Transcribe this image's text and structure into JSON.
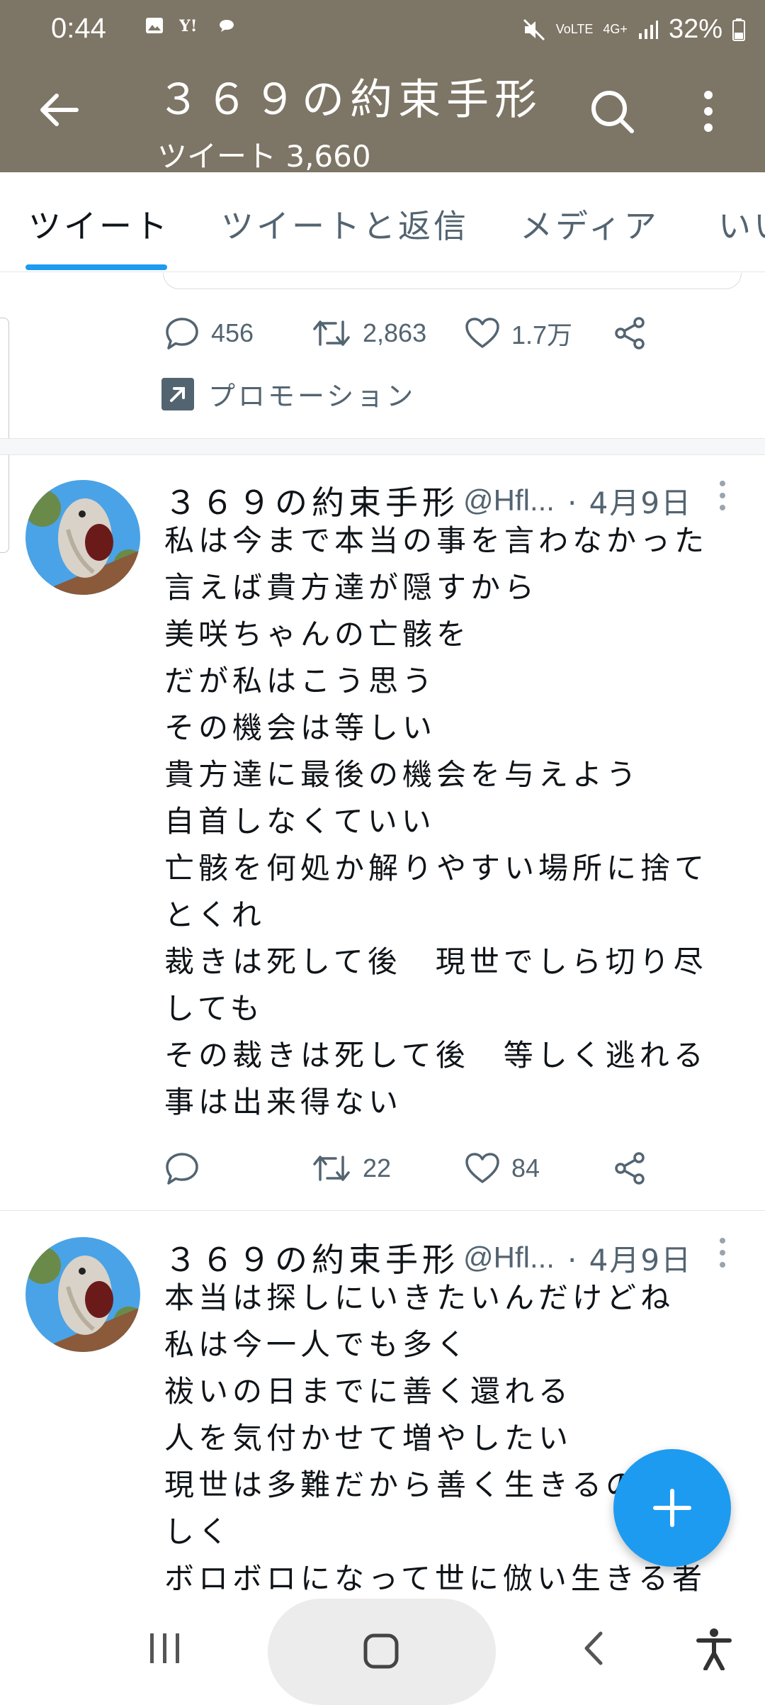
{
  "status_bar": {
    "time": "0:44",
    "left_icons": [
      "image-icon",
      "yahoo-icon",
      "bubble-icon"
    ],
    "mute_icon": "mute-icon",
    "volte": "VoLTE",
    "network": "4G+",
    "battery": "32%"
  },
  "header": {
    "title": "３６９の約束手形",
    "tweet_count": "ツイート 3,660"
  },
  "tabs": [
    {
      "label": "ツイート",
      "active": true
    },
    {
      "label": "ツイートと返信",
      "active": false
    },
    {
      "label": "メディア",
      "active": false
    },
    {
      "label": "いいね",
      "active": false
    }
  ],
  "prev_tweet": {
    "replies": "456",
    "retweets": "2,863",
    "likes": "1.7万",
    "promotion_label": "プロモーション"
  },
  "tweets": [
    {
      "name": "３６９の約束手形",
      "handle": "@Hfl...",
      "date": "· 4月9日",
      "lines": [
        "私は今まで本当の事を言わなかった",
        "言えば貴方達が隠すから",
        "美咲ちゃんの亡骸を",
        "だが私はこう思う",
        "その機会は等しい",
        "貴方達に最後の機会を与えよう",
        "自首しなくていい",
        "亡骸を何処か解りやすい場所に捨て",
        "とくれ",
        "裁きは死して後　現世でしら切り尽",
        "しても",
        "その裁きは死して後　等しく逃れる",
        "事は出来得ない"
      ],
      "replies": "",
      "retweets": "22",
      "likes": "84"
    },
    {
      "name": "３６９の約束手形",
      "handle": "@Hfl...",
      "date": "· 4月9日",
      "lines": [
        "本当は探しにいきたいんだけどね",
        "私は今一人でも多く",
        "祓いの日までに善く還れる",
        "人を気付かせて増やしたい",
        "現世は多難だから善く生きるのが難",
        "しく",
        "ボロボロになって世に倣い生きる者"
      ]
    }
  ],
  "colors": {
    "header_bg": "#7d7565",
    "accent": "#1d9bf0",
    "muted_text": "#536471"
  }
}
